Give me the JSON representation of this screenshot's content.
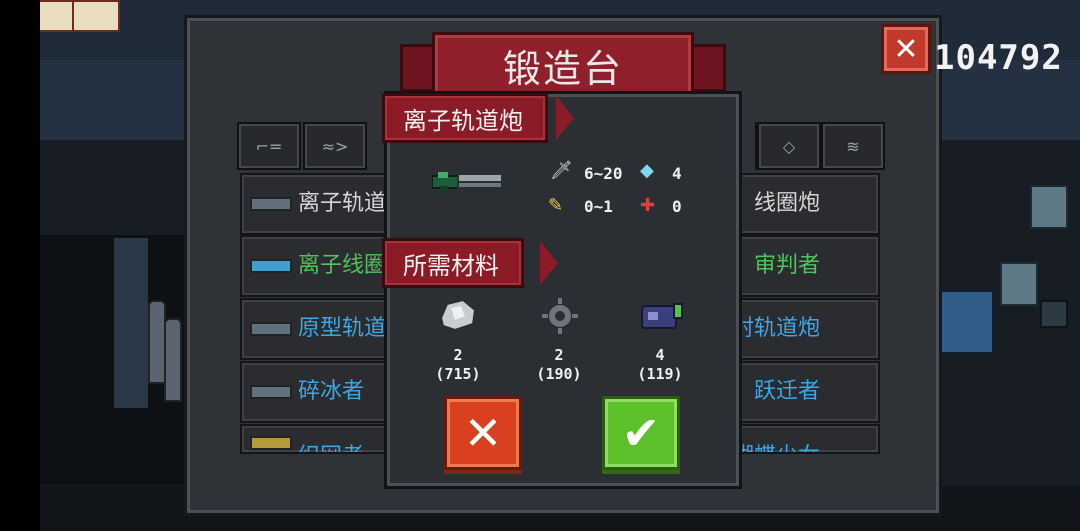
{
  "forge": {
    "title": "锻造台",
    "close_icon": "close-icon",
    "close_label": "✕"
  },
  "coins": "104792",
  "tabs": [
    {
      "icon": "pistol-icon",
      "glyph": "⌐="
    },
    {
      "icon": "rifle-icon",
      "glyph": "≈>"
    },
    {
      "icon": "weapon-icon",
      "glyph": ""
    },
    {
      "icon": "weapon-icon",
      "glyph": ""
    },
    {
      "icon": "weapon-icon",
      "glyph": ""
    },
    {
      "icon": "weapon-icon",
      "glyph": ""
    },
    {
      "icon": "weapon-icon",
      "glyph": ""
    },
    {
      "icon": "laser-gun-icon",
      "glyph": "→"
    },
    {
      "icon": "diamond-icon",
      "glyph": "◇"
    },
    {
      "icon": "shark-gun-icon",
      "glyph": "≋"
    }
  ],
  "list": [
    {
      "left": "离子轨道",
      "right": "线圈炮",
      "color": "white"
    },
    {
      "left": "离子线圈",
      "right": "审判者",
      "color": "green"
    },
    {
      "left": "原型轨道",
      "right": "单射轨道炮",
      "color": "blue"
    },
    {
      "left": "碎冰者",
      "right": "跃迁者",
      "color": "blue"
    },
    {
      "left": "织网者",
      "right": "蝴蝶少女",
      "color": "blue"
    }
  ],
  "dialog": {
    "weapon_name": "离子轨道炮",
    "materials_title": "所需材料",
    "stats": {
      "damage": "6~20",
      "energy": "4",
      "crit": "0~1",
      "spread": "0"
    },
    "materials": [
      {
        "icon": "ore-icon",
        "need": "2",
        "have": "(715)"
      },
      {
        "icon": "gear-icon",
        "need": "2",
        "have": "(190)"
      },
      {
        "icon": "battery-icon",
        "need": "4",
        "have": "(119)"
      }
    ],
    "cancel_label": "✕",
    "confirm_label": "✔"
  },
  "colors": {
    "white": "#d6d6d6",
    "green": "#4fc35c",
    "blue": "#3fa6e6"
  }
}
